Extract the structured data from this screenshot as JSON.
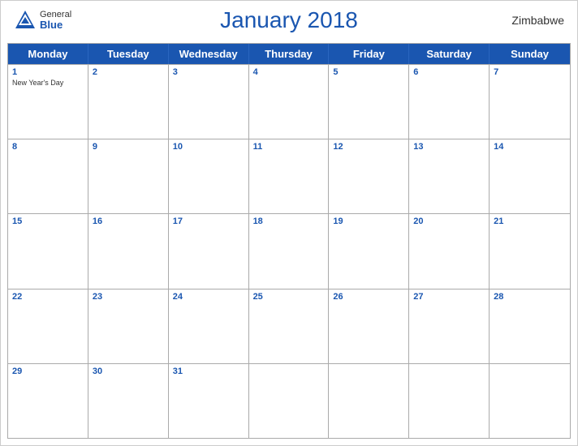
{
  "header": {
    "title": "January 2018",
    "country": "Zimbabwe",
    "logo": {
      "general": "General",
      "blue": "Blue"
    }
  },
  "days_of_week": [
    "Monday",
    "Tuesday",
    "Wednesday",
    "Thursday",
    "Friday",
    "Saturday",
    "Sunday"
  ],
  "weeks": [
    [
      {
        "day": 1,
        "event": "New Year's Day"
      },
      {
        "day": 2
      },
      {
        "day": 3
      },
      {
        "day": 4
      },
      {
        "day": 5
      },
      {
        "day": 6
      },
      {
        "day": 7
      }
    ],
    [
      {
        "day": 8
      },
      {
        "day": 9
      },
      {
        "day": 10
      },
      {
        "day": 11
      },
      {
        "day": 12
      },
      {
        "day": 13
      },
      {
        "day": 14
      }
    ],
    [
      {
        "day": 15
      },
      {
        "day": 16
      },
      {
        "day": 17
      },
      {
        "day": 18
      },
      {
        "day": 19
      },
      {
        "day": 20
      },
      {
        "day": 21
      }
    ],
    [
      {
        "day": 22
      },
      {
        "day": 23
      },
      {
        "day": 24
      },
      {
        "day": 25
      },
      {
        "day": 26
      },
      {
        "day": 27
      },
      {
        "day": 28
      }
    ],
    [
      {
        "day": 29
      },
      {
        "day": 30
      },
      {
        "day": 31
      },
      {
        "day": null
      },
      {
        "day": null
      },
      {
        "day": null
      },
      {
        "day": null
      }
    ]
  ]
}
